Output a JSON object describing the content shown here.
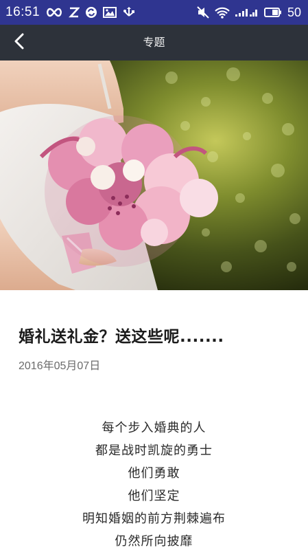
{
  "status_bar": {
    "time": "16:51",
    "battery_level": "50",
    "icons": [
      "infinity-icon",
      "z-app-icon",
      "sync-icon",
      "image-icon",
      "usb-icon",
      "mute-icon",
      "wifi-icon",
      "signal-icon",
      "battery-icon"
    ]
  },
  "navbar": {
    "title": "专题",
    "back_icon": "chevron-left-icon"
  },
  "article": {
    "title": "婚礼送礼金？送这些呢.......",
    "date": "2016年05月07日",
    "poem": [
      "每个步入婚典的人",
      "都是战时凯旋的勇士",
      "他们勇敢",
      "他们坚定",
      "明知婚姻的前方荆棘遍布",
      "仍然所向披靡"
    ]
  },
  "colors": {
    "status_bar_bg": "#2f3590",
    "nav_bar_bg": "#2d323a",
    "title_text": "#1b1b1b",
    "date_text": "#6a6a6a"
  }
}
